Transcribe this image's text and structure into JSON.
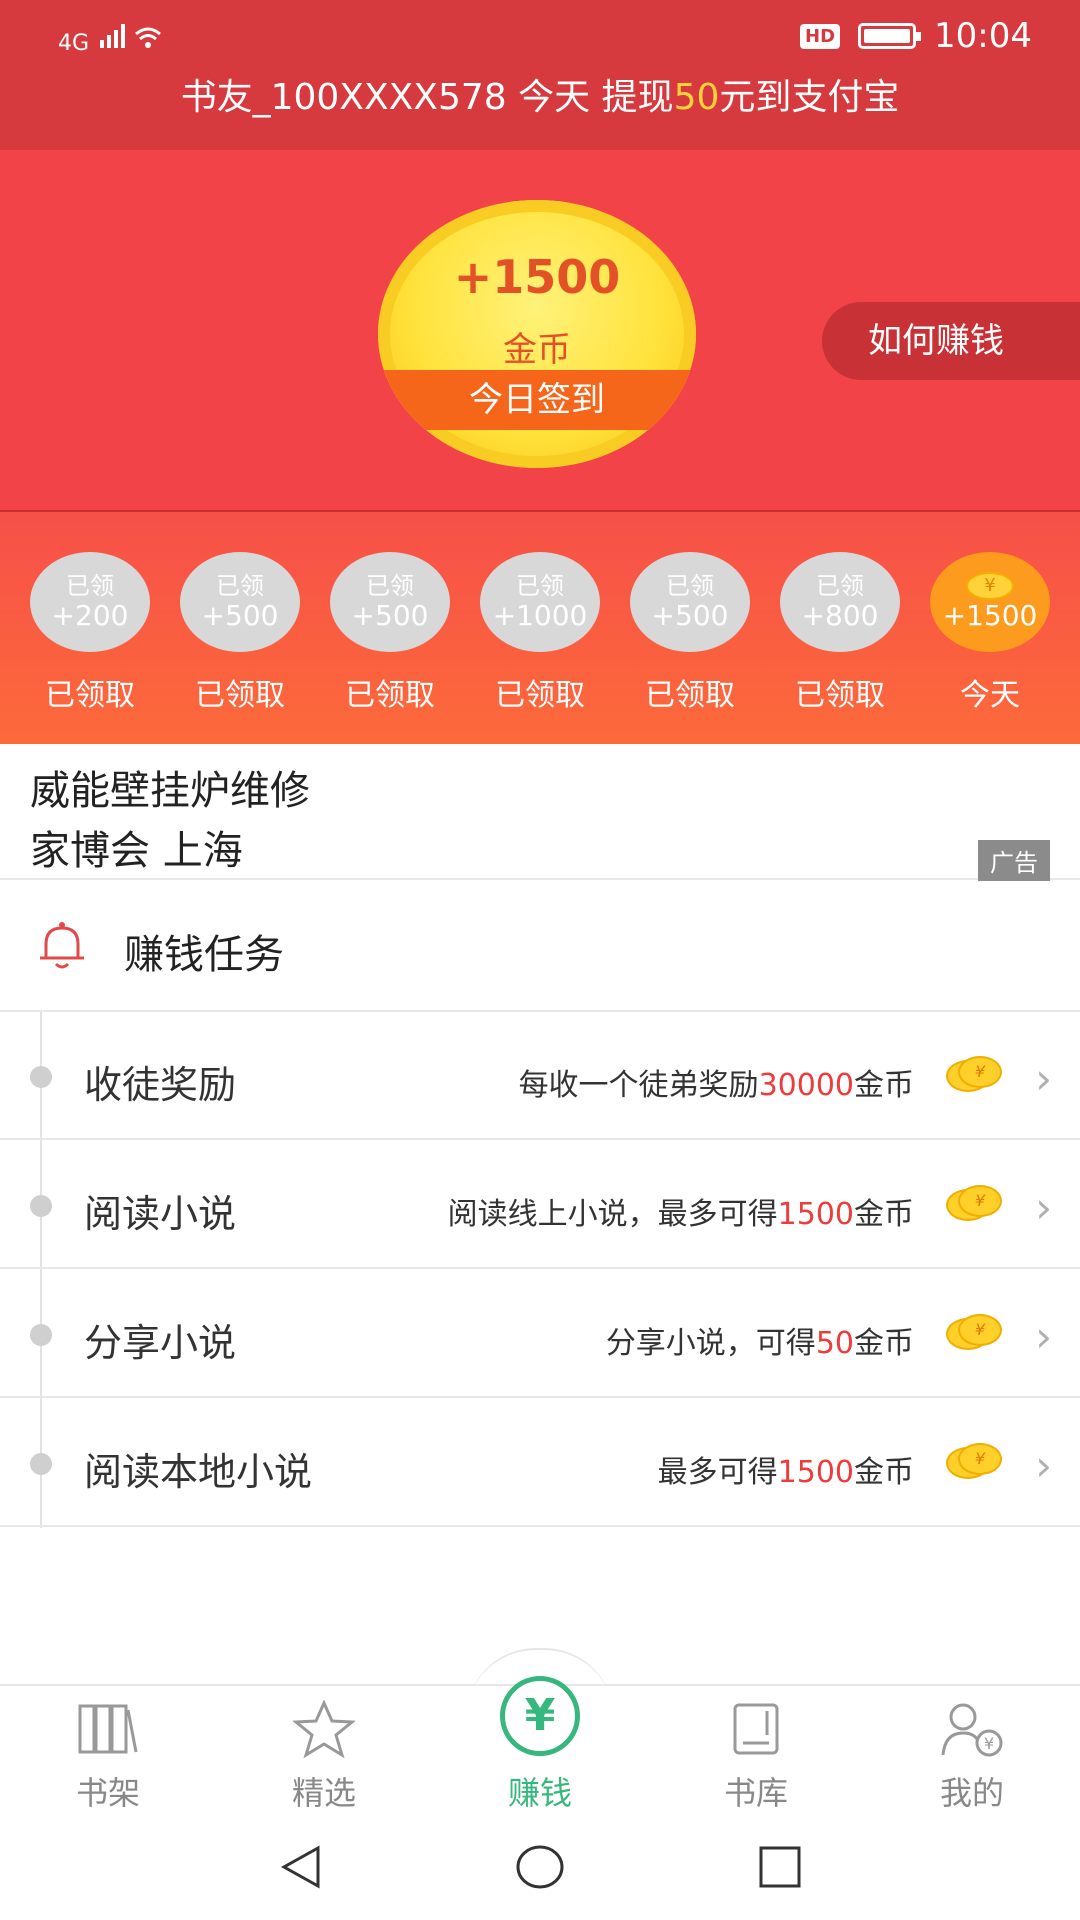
{
  "status_bar": {
    "network": "4G",
    "hd": "HD",
    "time": "10:04"
  },
  "ticker": {
    "prefix": "书友_100XXXX578 今天 提现",
    "amount": "50",
    "suffix": "元到支付宝"
  },
  "hero": {
    "coin_amount": "+1500",
    "coin_unit": "金币",
    "coin_ribbon": "今日签到",
    "how_to_earn": "如何赚钱"
  },
  "checkin_days": [
    {
      "status": "已领",
      "points": "+200",
      "label": "已领取"
    },
    {
      "status": "已领",
      "points": "+500",
      "label": "已领取"
    },
    {
      "status": "已领",
      "points": "+500",
      "label": "已领取"
    },
    {
      "status": "已领",
      "points": "+1000",
      "label": "已领取"
    },
    {
      "status": "已领",
      "points": "+500",
      "label": "已领取"
    },
    {
      "status": "已领",
      "points": "+800",
      "label": "已领取"
    },
    {
      "status": "",
      "points": "+1500",
      "label": "今天"
    }
  ],
  "ad": {
    "line1": "威能壁挂炉维修",
    "line2": "家博会 上海",
    "tag": "广告"
  },
  "tasks_section": {
    "title": "赚钱任务"
  },
  "tasks": [
    {
      "name": "收徒奖励",
      "desc_prefix": "每收一个徒弟奖励",
      "highlight": "30000",
      "desc_suffix": "金币"
    },
    {
      "name": "阅读小说",
      "desc_prefix": "阅读线上小说，最多可得",
      "highlight": "1500",
      "desc_suffix": "金币"
    },
    {
      "name": "分享小说",
      "desc_prefix": "分享小说，可得",
      "highlight": "50",
      "desc_suffix": "金币"
    },
    {
      "name": "阅读本地小说",
      "desc_prefix": "最多可得",
      "highlight": "1500",
      "desc_suffix": "金币"
    }
  ],
  "tabbar": {
    "tabs": [
      {
        "label": "书架",
        "icon": "bookshelf-icon"
      },
      {
        "label": "精选",
        "icon": "star-icon"
      },
      {
        "label": "赚钱",
        "icon": "yuan-icon"
      },
      {
        "label": "书库",
        "icon": "book-icon"
      },
      {
        "label": "我的",
        "icon": "user-icon"
      }
    ],
    "active_color": "#36b77d",
    "inactive_color": "#888888"
  },
  "colors": {
    "header_red": "#d63a3f",
    "hero_red": "#f24448",
    "highlight_red": "#ee3b3b",
    "gold": "#ffd23a"
  }
}
